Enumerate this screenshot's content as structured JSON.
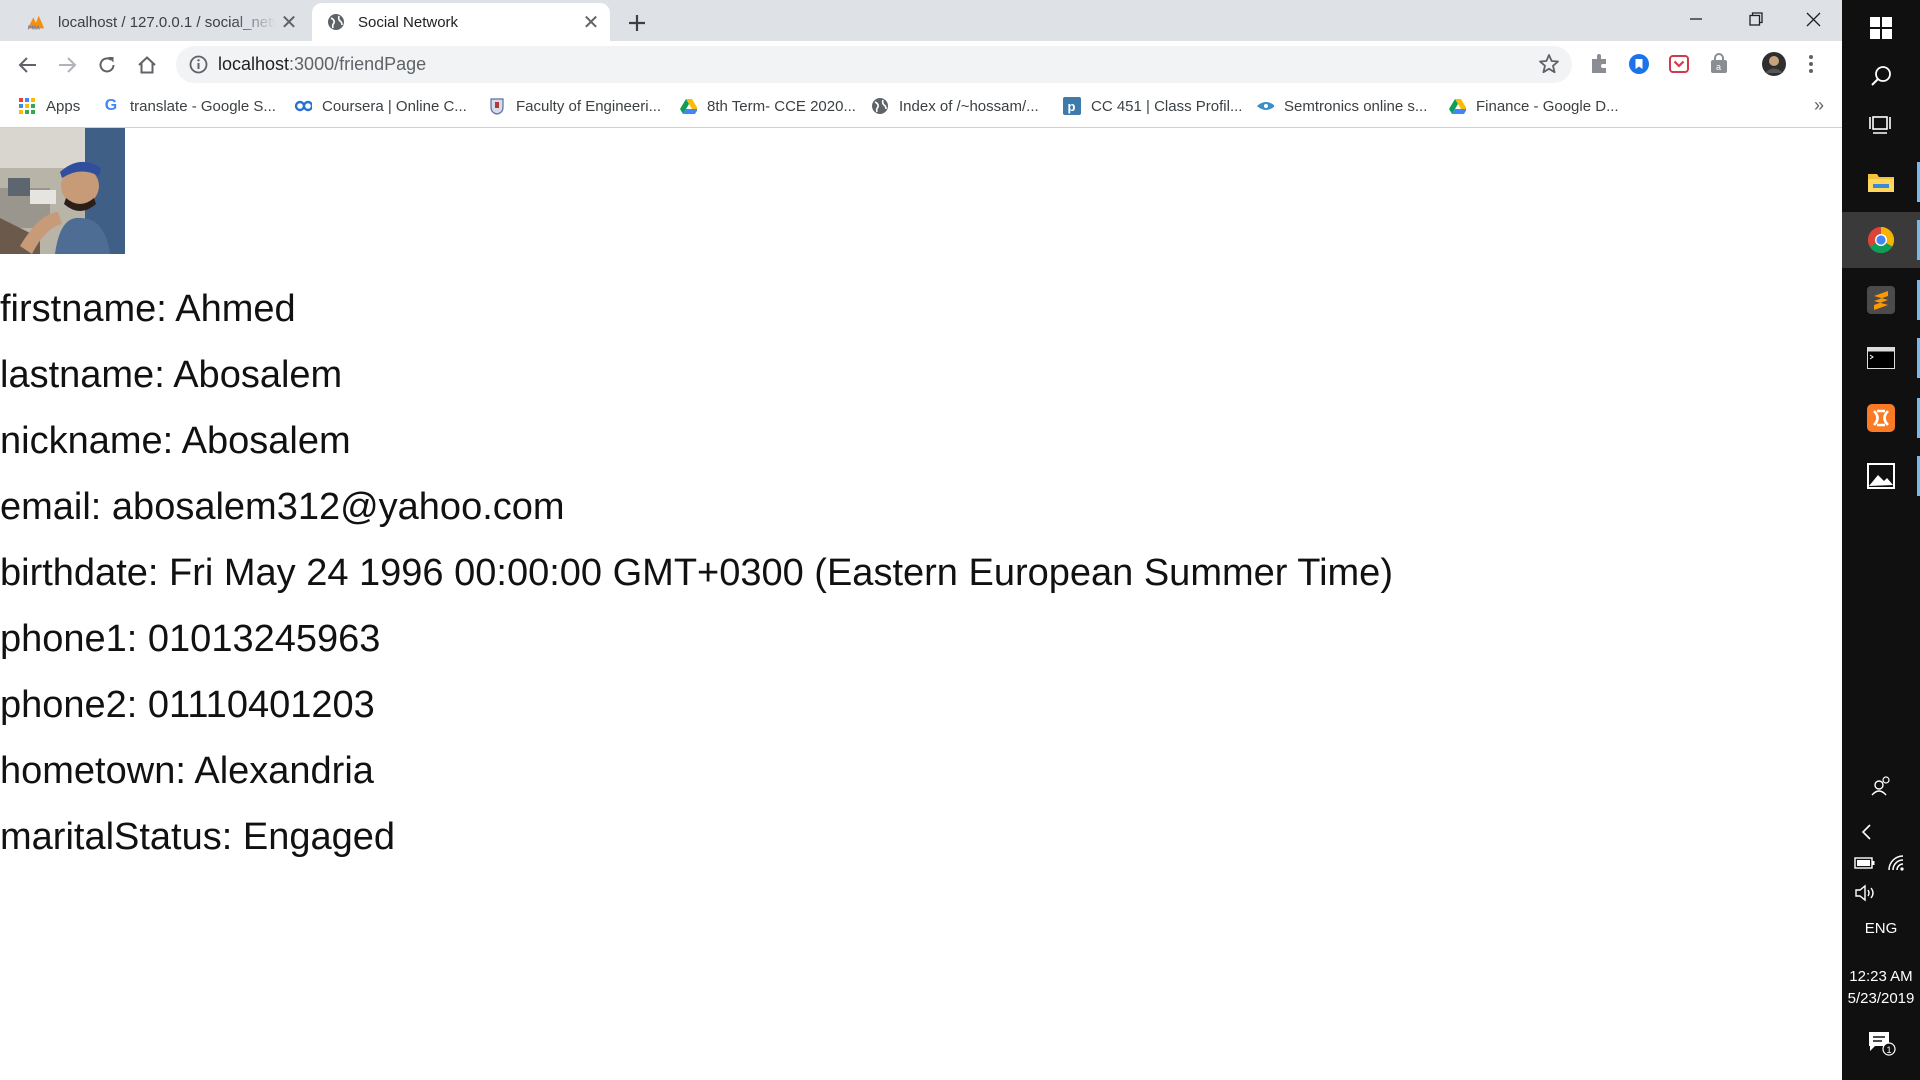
{
  "browser": {
    "tabs": [
      {
        "title": "localhost / 127.0.0.1 / social_network",
        "icon": "phpmyadmin-icon"
      },
      {
        "title": "Social Network",
        "icon": "globe-icon"
      }
    ],
    "address": {
      "host": "localhost",
      "path": ":3000/friendPage"
    },
    "bookmarks": [
      {
        "label": "Apps",
        "icon": "apps-grid-icon"
      },
      {
        "label": "translate - Google S...",
        "icon": "google-icon"
      },
      {
        "label": "Coursera | Online C...",
        "icon": "coursera-icon"
      },
      {
        "label": "Faculty of Engineeri...",
        "icon": "university-crest-icon"
      },
      {
        "label": "8th Term- CCE 2020...",
        "icon": "google-drive-icon"
      },
      {
        "label": "Index of /~hossam/...",
        "icon": "globe-icon"
      },
      {
        "label": "CC 451 | Class Profil...",
        "icon": "piazza-icon"
      },
      {
        "label": "Semtronics online s...",
        "icon": "semtronics-icon"
      },
      {
        "label": "Finance - Google D...",
        "icon": "google-drive-icon"
      }
    ],
    "bookmarks_more": "»"
  },
  "profile": {
    "fields": [
      "firstname: Ahmed",
      "lastname: Abosalem",
      "nickname: Abosalem",
      "email: abosalem312@yahoo.com",
      "birthdate: Fri May 24 1996 00:00:00 GMT+0300 (Eastern European Summer Time)",
      "phone1: 01013245963",
      "phone2: 01110401203",
      "hometown: Alexandria",
      "maritalStatus: Engaged"
    ]
  },
  "taskbar": {
    "language": "ENG",
    "time": "12:23 AM",
    "date": "5/23/2019",
    "notification_count": "1"
  },
  "colors": {
    "accent": "#1a73e8",
    "taskbar": "#101010",
    "tabstrip": "#dee1e6"
  }
}
